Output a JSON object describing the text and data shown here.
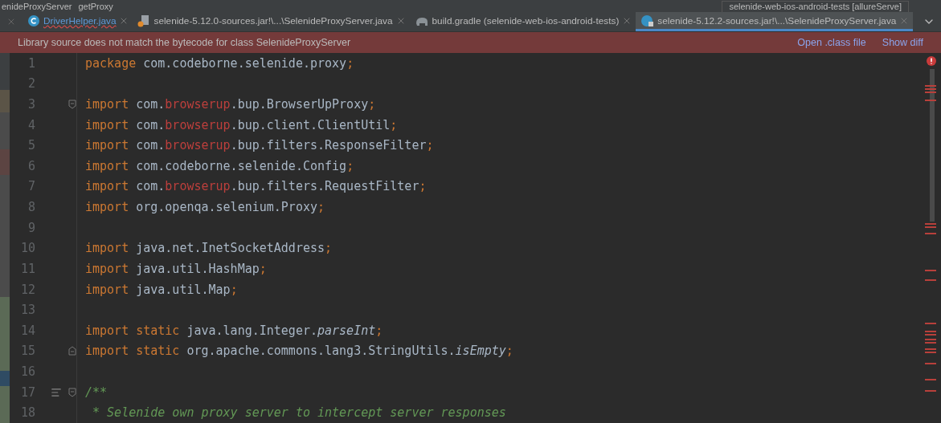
{
  "breadcrumb": [
    {
      "label": "enideProxyServer"
    },
    {
      "label": "getProxy"
    }
  ],
  "run_config": {
    "label": "selenide-web-ios-android-tests [allureServe]"
  },
  "tabs": [
    {
      "label": "DriverHelper.java",
      "kind": "class",
      "error": true,
      "selected": false
    },
    {
      "label": "selenide-5.12.0-sources.jar!\\...\\SelenideProxyServer.java",
      "kind": "jar",
      "error": false,
      "selected": false
    },
    {
      "label": "build.gradle (selenide-web-ios-android-tests)",
      "kind": "gradle",
      "error": false,
      "selected": false
    },
    {
      "label": "selenide-5.12.2-sources.jar!\\...\\SelenideProxyServer.java",
      "kind": "locked-class",
      "error": false,
      "selected": true
    }
  ],
  "banner": {
    "message": "Library source does not match the bytecode for class SelenideProxyServer",
    "actions": [
      "Open .class file",
      "Show diff"
    ]
  },
  "lines": [
    {
      "number": "1",
      "kind": "code",
      "segments": [
        {
          "kind": "keyword",
          "text": "package"
        },
        {
          "kind": "plain",
          "text": " com.codeborne.selenide.proxy"
        },
        {
          "kind": "punct",
          "text": ";"
        }
      ]
    },
    {
      "number": "2",
      "kind": "code"
    },
    {
      "number": "3",
      "kind": "fold-start",
      "segments": [
        {
          "kind": "keyword",
          "text": "import"
        },
        {
          "kind": "plain",
          "text": " com."
        },
        {
          "kind": "error",
          "text": "browserup"
        },
        {
          "kind": "plain",
          "text": ".bup.BrowserUpProxy"
        },
        {
          "kind": "punct",
          "text": ";"
        }
      ]
    },
    {
      "number": "4",
      "kind": "code",
      "segments": [
        {
          "kind": "keyword",
          "text": "import"
        },
        {
          "kind": "plain",
          "text": " com."
        },
        {
          "kind": "error",
          "text": "browserup"
        },
        {
          "kind": "plain",
          "text": ".bup.client.ClientUtil"
        },
        {
          "kind": "punct",
          "text": ";"
        }
      ]
    },
    {
      "number": "5",
      "kind": "code",
      "segments": [
        {
          "kind": "keyword",
          "text": "import"
        },
        {
          "kind": "plain",
          "text": " com."
        },
        {
          "kind": "error",
          "text": "browserup"
        },
        {
          "kind": "plain",
          "text": ".bup.filters.ResponseFilter"
        },
        {
          "kind": "punct",
          "text": ";"
        }
      ]
    },
    {
      "number": "6",
      "kind": "code",
      "segments": [
        {
          "kind": "keyword",
          "text": "import"
        },
        {
          "kind": "plain",
          "text": " com.codeborne.selenide.Config"
        },
        {
          "kind": "punct",
          "text": ";"
        }
      ]
    },
    {
      "number": "7",
      "kind": "code",
      "segments": [
        {
          "kind": "keyword",
          "text": "import"
        },
        {
          "kind": "plain",
          "text": " com."
        },
        {
          "kind": "error",
          "text": "browserup"
        },
        {
          "kind": "plain",
          "text": ".bup.filters.RequestFilter"
        },
        {
          "kind": "punct",
          "text": ";"
        }
      ]
    },
    {
      "number": "8",
      "kind": "code",
      "segments": [
        {
          "kind": "keyword",
          "text": "import"
        },
        {
          "kind": "plain",
          "text": " org.openqa.selenium.Proxy"
        },
        {
          "kind": "punct",
          "text": ";"
        }
      ]
    },
    {
      "number": "9",
      "kind": "code"
    },
    {
      "number": "10",
      "kind": "code",
      "segments": [
        {
          "kind": "keyword",
          "text": "import"
        },
        {
          "kind": "plain",
          "text": " java.net.InetSocketAddress"
        },
        {
          "kind": "punct",
          "text": ";"
        }
      ]
    },
    {
      "number": "11",
      "kind": "code",
      "segments": [
        {
          "kind": "keyword",
          "text": "import"
        },
        {
          "kind": "plain",
          "text": " java.util.HashMap"
        },
        {
          "kind": "punct",
          "text": ";"
        }
      ]
    },
    {
      "number": "12",
      "kind": "code",
      "segments": [
        {
          "kind": "keyword",
          "text": "import"
        },
        {
          "kind": "plain",
          "text": " java.util.Map"
        },
        {
          "kind": "punct",
          "text": ";"
        }
      ]
    },
    {
      "number": "13",
      "kind": "code"
    },
    {
      "number": "14",
      "kind": "code",
      "segments": [
        {
          "kind": "keyword",
          "text": "import static"
        },
        {
          "kind": "plain",
          "text": " java.lang.Integer."
        },
        {
          "kind": "italic",
          "text": "parseInt"
        },
        {
          "kind": "punct",
          "text": ";"
        }
      ]
    },
    {
      "number": "15",
      "kind": "fold-end",
      "segments": [
        {
          "kind": "keyword",
          "text": "import static"
        },
        {
          "kind": "plain",
          "text": " org.apache.commons.lang3.StringUtils."
        },
        {
          "kind": "italic",
          "text": "isEmpty"
        },
        {
          "kind": "punct",
          "text": ";"
        }
      ]
    },
    {
      "number": "16",
      "kind": "code"
    },
    {
      "number": "17",
      "kind": "doc-fold-start",
      "segments": [
        {
          "kind": "comment",
          "text": "/**"
        }
      ]
    },
    {
      "number": "18",
      "kind": "code",
      "segments": [
        {
          "kind": "comment",
          "text": " * Selenide own proxy server to intercept server responses"
        }
      ]
    }
  ]
}
